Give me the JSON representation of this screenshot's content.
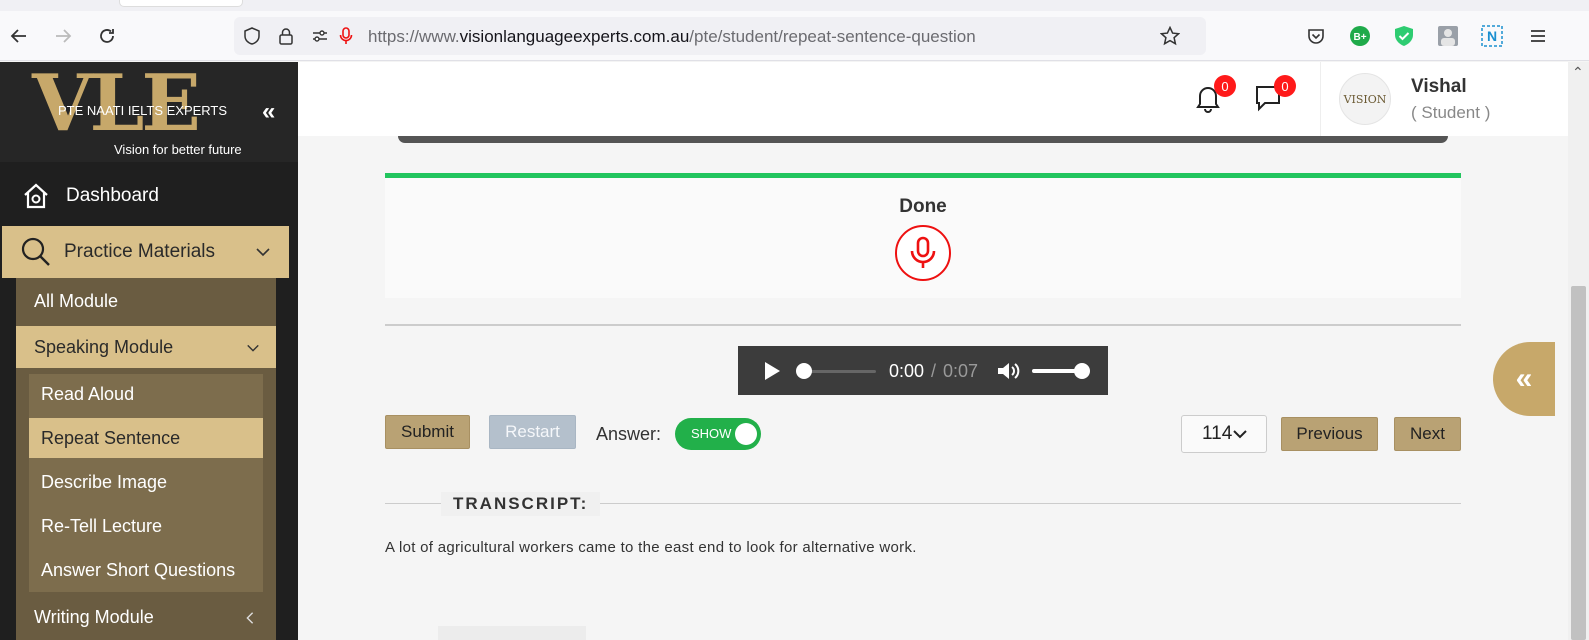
{
  "browser": {
    "url_prefix": "https://www.",
    "url_domain": "visionlanguageexperts.com.au",
    "url_path": "/pte/student/repeat-sentence-question"
  },
  "sidebar": {
    "logo_text": "VLE",
    "logo_tagline_top": "PTE NAATI IELTS EXPERTS",
    "logo_tagline_bottom": "Vision for better future",
    "collapse_glyph": "«",
    "dashboard": "Dashboard",
    "practice": "Practice Materials",
    "modules": [
      {
        "label": "All Module"
      },
      {
        "label": "Speaking Module"
      },
      {
        "label": "Writing Module"
      }
    ],
    "speaking_items": [
      {
        "label": "Read Aloud"
      },
      {
        "label": "Repeat Sentence"
      },
      {
        "label": "Describe Image"
      },
      {
        "label": "Re-Tell Lecture"
      },
      {
        "label": "Answer Short Questions"
      }
    ]
  },
  "header": {
    "notifications_count": "0",
    "messages_count": "0",
    "user_name": "Vishal",
    "user_role": "( Student )",
    "avatar_text": "VISION"
  },
  "recorder": {
    "status": "Done"
  },
  "audio": {
    "current": "0:00",
    "separator": "/",
    "total": "0:07"
  },
  "controls": {
    "submit": "Submit",
    "restart": "Restart",
    "answer_label": "Answer:",
    "toggle_label": "SHOW",
    "question_number": "114",
    "previous": "Previous",
    "next": "Next"
  },
  "transcript": {
    "title": "TRANSCRIPT:",
    "text": "A lot of agricultural workers came to the east end to look for alternative work."
  },
  "float_button_glyph": "«",
  "colors": {
    "gold": "#d9c08a",
    "progress_green": "#22c55e",
    "mic_red": "#ee1111",
    "toggle_green": "#22b04a"
  }
}
